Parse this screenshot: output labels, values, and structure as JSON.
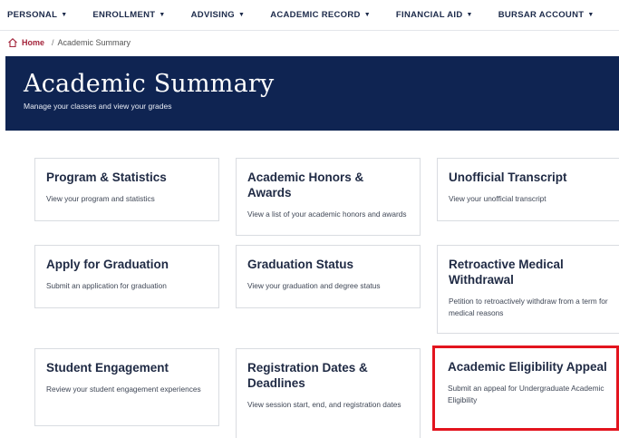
{
  "nav": [
    {
      "label": "PERSONAL",
      "dropdown": true
    },
    {
      "label": "ENROLLMENT",
      "dropdown": true
    },
    {
      "label": "ADVISING",
      "dropdown": true
    },
    {
      "label": "ACADEMIC RECORD",
      "dropdown": true
    },
    {
      "label": "FINANCIAL AID",
      "dropdown": true
    },
    {
      "label": "BURSAR ACCOUNT",
      "dropdown": true
    }
  ],
  "nav_caret": "▼",
  "breadcrumb": {
    "home": "Home",
    "separator": "/",
    "current": "Academic Summary"
  },
  "hero": {
    "title": "Academic Summary",
    "subtitle": "Manage your classes and view your grades"
  },
  "cards": [
    {
      "title": "Program & Statistics",
      "desc": "View your program and statistics"
    },
    {
      "title": "Academic Honors & Awards",
      "desc": "View a list of your academic honors and awards"
    },
    {
      "title": "Unofficial Transcript",
      "desc": "View your unofficial transcript"
    },
    {
      "title": "Apply for Graduation",
      "desc": "Submit an application for graduation"
    },
    {
      "title": "Graduation Status",
      "desc": "View your graduation and degree status"
    },
    {
      "title": "Retroactive Medical Withdrawal",
      "desc": "Petition to retroactively withdraw from a term for medical reasons"
    },
    {
      "title": "Student Engagement",
      "desc": "Review your student engagement experiences"
    },
    {
      "title": "Registration Dates & Deadlines",
      "desc": "View session start, end, and registration dates"
    },
    {
      "title": "Academic Eligibility Appeal",
      "desc": "Submit an appeal for Undergraduate Academic Eligibility"
    }
  ],
  "colors": {
    "hero_bg": "#0f2452",
    "accent": "#a3233a",
    "highlight": "#e3141e"
  }
}
